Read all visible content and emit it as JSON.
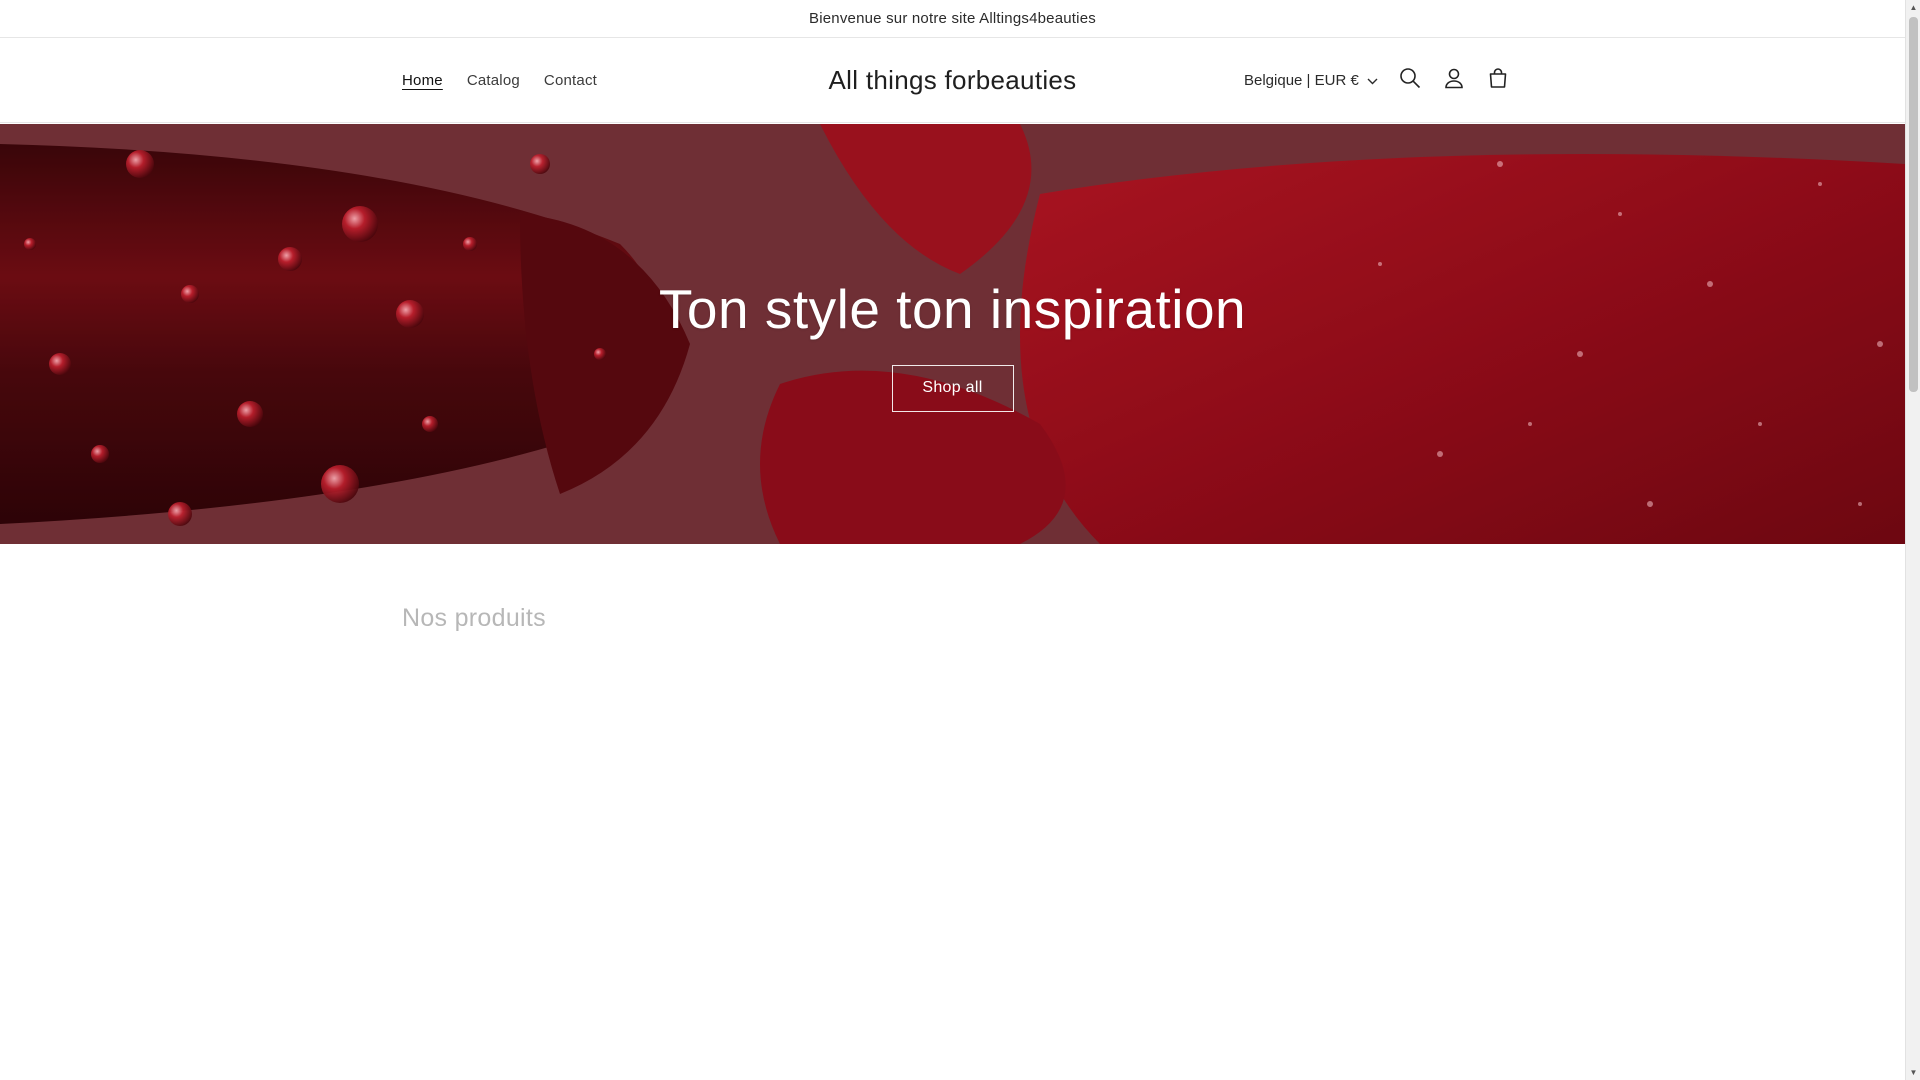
{
  "announcement": {
    "text": "Bienvenue sur notre site Alltings4beauties"
  },
  "nav": [
    {
      "label": "Home",
      "active": true
    },
    {
      "label": "Catalog",
      "active": false
    },
    {
      "label": "Contact",
      "active": false
    }
  ],
  "logo": {
    "text": "All things forbeauties"
  },
  "header": {
    "locale": "Belgique | EUR €",
    "icons": [
      "chevron-down-icon",
      "search-icon",
      "account-icon",
      "cart-icon"
    ]
  },
  "hero": {
    "title": "Ton style ton inspiration",
    "button": "Shop all"
  },
  "products": {
    "title": "Nos produits"
  },
  "colors": {
    "hero_red": "#c2111f",
    "hero_dark": "#5a0a10",
    "text": "#121212",
    "muted_heading": "#b7b7b7"
  }
}
